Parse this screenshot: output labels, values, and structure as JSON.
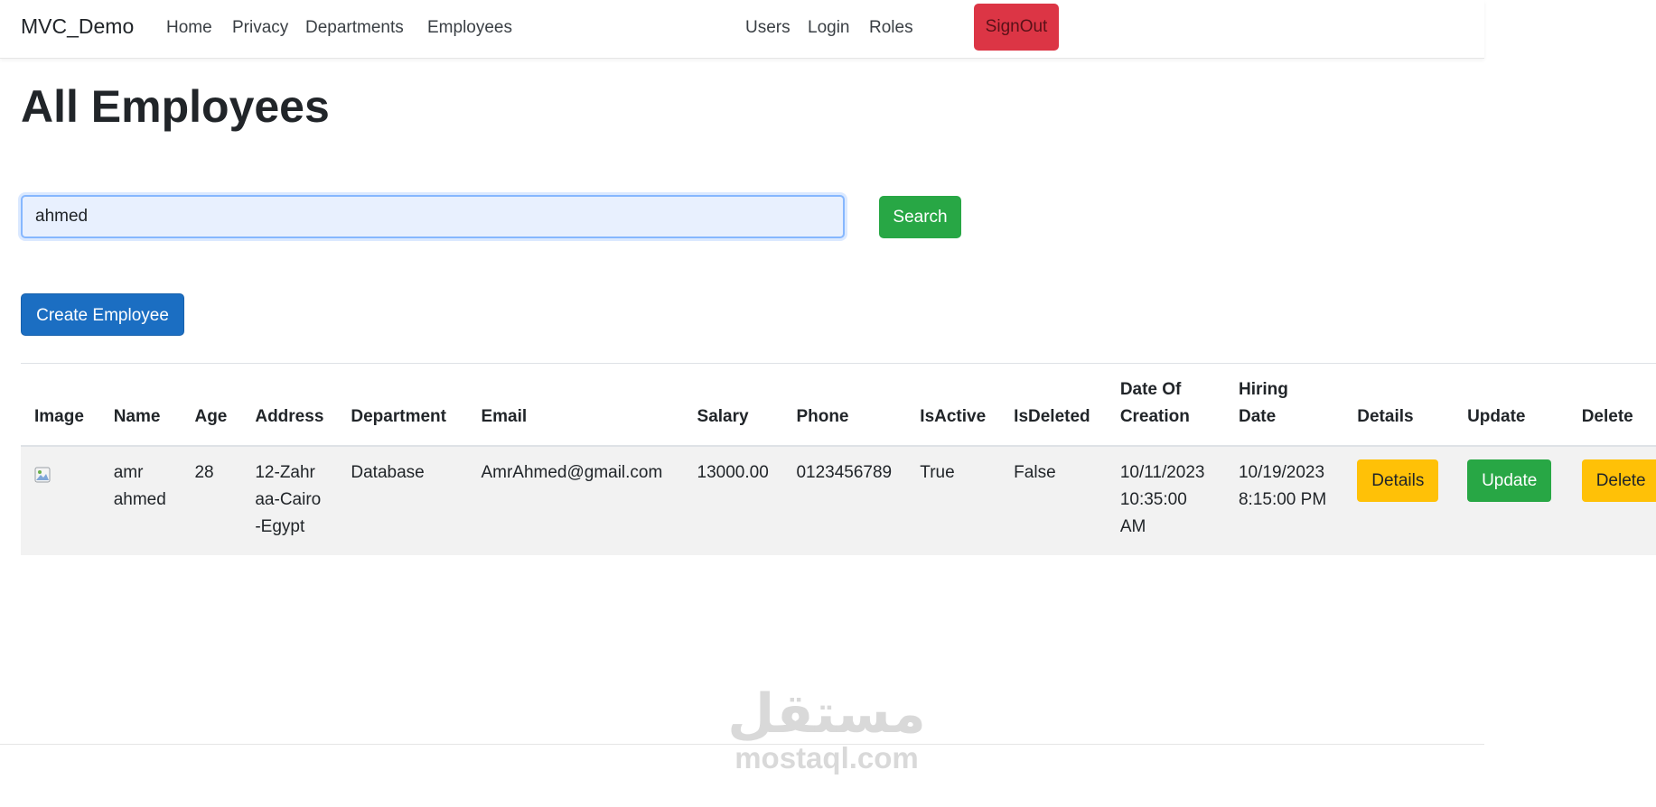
{
  "navbar": {
    "brand": "MVC_Demo",
    "links": [
      "Home",
      "Privacy",
      "Departments",
      "Employees"
    ],
    "right_links": [
      "Users",
      "Login",
      "Roles"
    ],
    "signout": "SignOut"
  },
  "page": {
    "title": "All Employees"
  },
  "search": {
    "value": "ahmed",
    "button": "Search"
  },
  "create_button": "Create Employee",
  "table": {
    "headers": [
      "Image",
      "Name",
      "Age",
      "Address",
      "Department",
      "Email",
      "Salary",
      "Phone",
      "IsActive",
      "IsDeleted",
      "Date Of Creation",
      "Hiring Date",
      "Details",
      "Update",
      "Delete"
    ],
    "rows": [
      {
        "name": "amr ahmed",
        "age": "28",
        "address": "12-Zahraa-Cairo-Egypt",
        "department": "Database",
        "email": "AmrAhmed@gmail.com",
        "salary": "13000.00",
        "phone": "0123456789",
        "is_active": "True",
        "is_deleted": "False",
        "date_of_creation": "10/11/2023 10:35:00 AM",
        "hiring_date": "10/19/2023 8:15:00 PM",
        "details_label": "Details",
        "update_label": "Update",
        "delete_label": "Delete"
      }
    ]
  },
  "watermark": {
    "arabic": "مستقل",
    "latin": "mostaql.com"
  },
  "colors": {
    "danger": "#dc3545",
    "success": "#28a745",
    "primary": "#1b6ec2",
    "warning": "#ffc107"
  },
  "icons": {
    "broken_image": "broken-image-icon"
  }
}
